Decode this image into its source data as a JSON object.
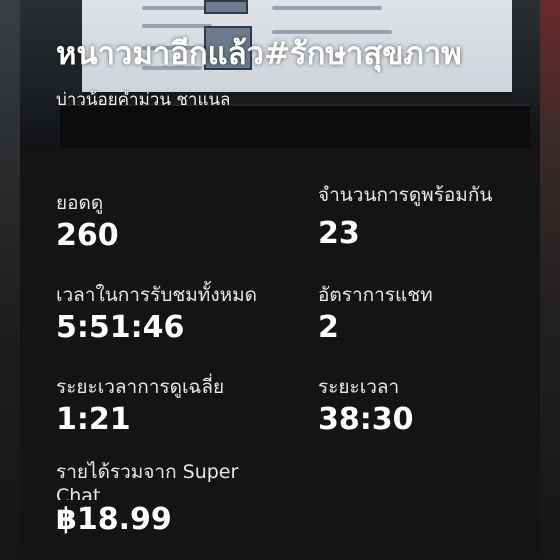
{
  "video": {
    "title": "หนาวมาอีกแล้ว#รักษาสุขภาพ",
    "channel": "บ่าวน้อยคำม่วน ชาแนล"
  },
  "stats": {
    "views": {
      "label": "ยอดดู",
      "value": "260"
    },
    "concurrent": {
      "label": "จำนวนการดูพร้อมกัน",
      "value": "23"
    },
    "watch_time": {
      "label": "เวลาในการรับชมทั้งหมด",
      "value": "5:51:46"
    },
    "chat_rate": {
      "label": "อัตราการแชท",
      "value": "2"
    },
    "avg_duration": {
      "label": "ระยะเวลาการดูเฉลี่ย",
      "value": "1:21"
    },
    "duration": {
      "label": "ระยะเวลา",
      "value": "38:30"
    },
    "super_chat": {
      "label": "รายได้รวมจาก Super Chat",
      "value": "฿18.99"
    }
  }
}
